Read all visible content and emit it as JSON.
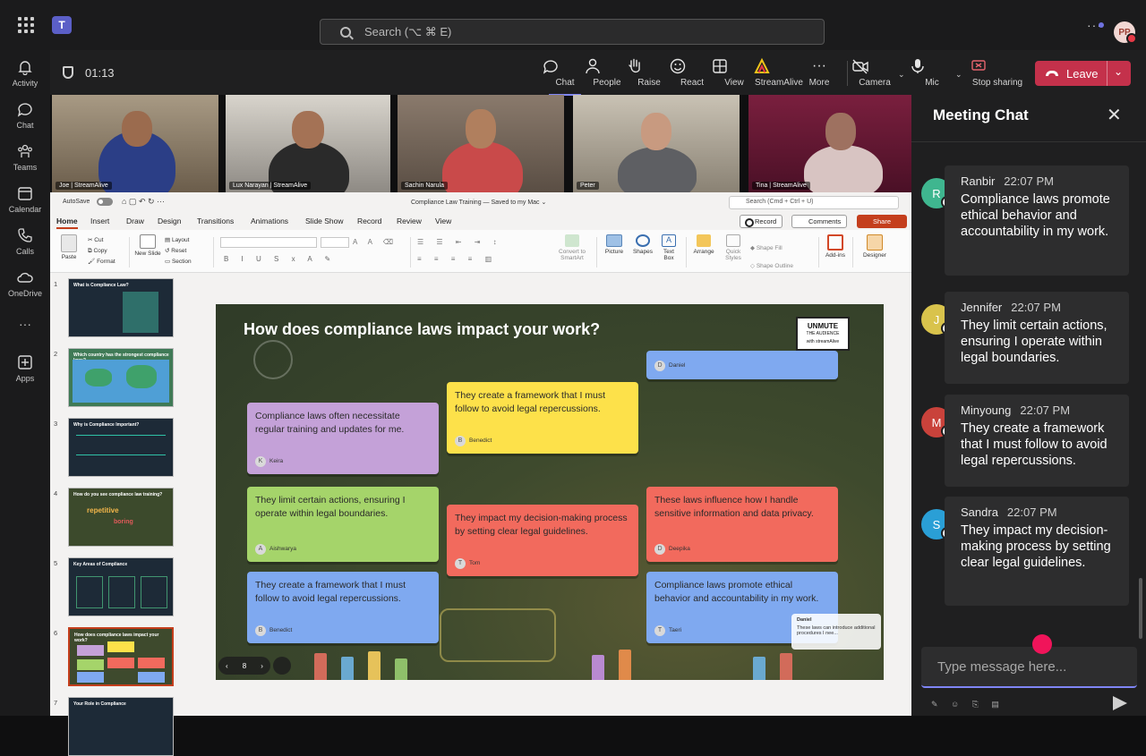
{
  "titlebar": {
    "search_placeholder": "Search (⌥ ⌘ E)",
    "avatar_initials": "PP",
    "more": "···"
  },
  "rail": {
    "items": [
      {
        "label": "Activity",
        "icon": "bell-icon"
      },
      {
        "label": "Chat",
        "icon": "chat-icon"
      },
      {
        "label": "Teams",
        "icon": "teams-icon"
      },
      {
        "label": "Calendar",
        "icon": "calendar-icon"
      },
      {
        "label": "Calls",
        "icon": "phone-icon"
      },
      {
        "label": "OneDrive",
        "icon": "cloud-icon"
      },
      {
        "label": "···",
        "icon": "more-icon"
      },
      {
        "label": "Apps",
        "icon": "add-icon"
      }
    ]
  },
  "meeting": {
    "timer": "01:13",
    "buttons": {
      "chat": "Chat",
      "people": "People",
      "raise": "Raise",
      "react": "React",
      "view": "View",
      "streamalive": "StreamAlive",
      "more": "More",
      "camera": "Camera",
      "mic": "Mic",
      "stop_sharing": "Stop sharing",
      "leave": "Leave"
    }
  },
  "videos": [
    {
      "name": "Joe | StreamAlive"
    },
    {
      "name": "Lux Narayan | StreamAlive"
    },
    {
      "name": "Sachin Narula"
    },
    {
      "name": "Peter"
    },
    {
      "name": "Tina | StreamAlive"
    }
  ],
  "ppt": {
    "autosave": "AutoSave",
    "doc_title": "Compliance Law Training — Saved to my Mac ⌄",
    "search": "Search (Cmd + Ctrl + U)",
    "tabs": [
      "Home",
      "Insert",
      "Draw",
      "Design",
      "Transitions",
      "Animations",
      "Slide Show",
      "Record",
      "Review",
      "View"
    ],
    "record": "Record",
    "comments": "Comments",
    "share": "Share",
    "ribbon": {
      "paste": "Paste",
      "cut": "Cut",
      "copy": "Copy",
      "format": "Format",
      "new_slide": "New Slide",
      "layout": "Layout",
      "reset": "Reset",
      "section": "Section",
      "convert": "Convert to SmartArt",
      "picture": "Picture",
      "shapes": "Shapes",
      "text_box": "Text Box",
      "arrange": "Arrange",
      "quick_styles": "Quick Styles",
      "shape_fill": "Shape Fill",
      "shape_outline": "Shape Outline",
      "addins": "Add-ins",
      "designer": "Designer"
    },
    "thumbnails": [
      {
        "num": "1",
        "title": "What is Compliance Law?"
      },
      {
        "num": "2",
        "title": "Which country has the strongest compliance laws?"
      },
      {
        "num": "3",
        "title": "Why is Compliance Important?"
      },
      {
        "num": "4",
        "title": "How do you see compliance law training?"
      },
      {
        "num": "5",
        "title": "Key Areas of Compliance"
      },
      {
        "num": "6",
        "title": "How does compliance laws impact your work?"
      },
      {
        "num": "7",
        "title": "Your Role in Compliance"
      }
    ],
    "slide": {
      "title": "How does compliance laws impact your work?",
      "badge_line1": "UNMUTE",
      "badge_line2": "THE AUDIENCE",
      "badge_line3": "with streamAlive",
      "page": "8",
      "cards": [
        {
          "text": "Compliance laws often necessitate regular training and updates for me.",
          "author": "Keira",
          "initial": "K"
        },
        {
          "text": "They create a framework that I must follow to avoid legal repercussions.",
          "author": "Benedict",
          "initial": "B"
        },
        {
          "text": "",
          "author": "Daniel",
          "initial": "D"
        },
        {
          "text": "They limit certain actions, ensuring I operate within legal boundaries.",
          "author": "Aishwarya",
          "initial": "A"
        },
        {
          "text": "They impact my decision-making process by setting clear legal guidelines.",
          "author": "Tom",
          "initial": "T"
        },
        {
          "text": "These laws influence how I handle sensitive information and data privacy.",
          "author": "Deepika",
          "initial": "D"
        },
        {
          "text": "They create a framework that I must follow to avoid legal repercussions.",
          "author": "Benedict",
          "initial": "B"
        },
        {
          "text": "Compliance laws promote ethical behavior and accountability in my work.",
          "author": "Taeri",
          "initial": "T"
        }
      ],
      "popup_name": "Daniel",
      "popup_text": "These laws can introduce additional procedures I nee..."
    }
  },
  "chat": {
    "title": "Meeting Chat",
    "messages": [
      {
        "initial": "R",
        "name": "Ranbir",
        "time": "22:07 PM",
        "text": "Compliance laws promote ethical behavior and accountability in my work.",
        "color": "#3fb68f"
      },
      {
        "initial": "J",
        "name": "Jennifer",
        "time": "22:07 PM",
        "text": "They limit certain actions, ensuring I operate within legal boundaries.",
        "color": "#d9c34c"
      },
      {
        "initial": "M",
        "name": "Minyoung",
        "time": "22:07 PM",
        "text": "They create a framework that I must follow to avoid legal repercussions.",
        "color": "#c9423b"
      },
      {
        "initial": "S",
        "name": "Sandra",
        "time": "22:07 PM",
        "text": "They impact my decision-making process by setting clear legal guidelines.",
        "color": "#2a9fd6"
      }
    ],
    "input_placeholder": "Type message here..."
  },
  "colors": {
    "accent": "#7f85f5",
    "leave": "#c4314b",
    "ppt_accent": "#c43e1c"
  }
}
